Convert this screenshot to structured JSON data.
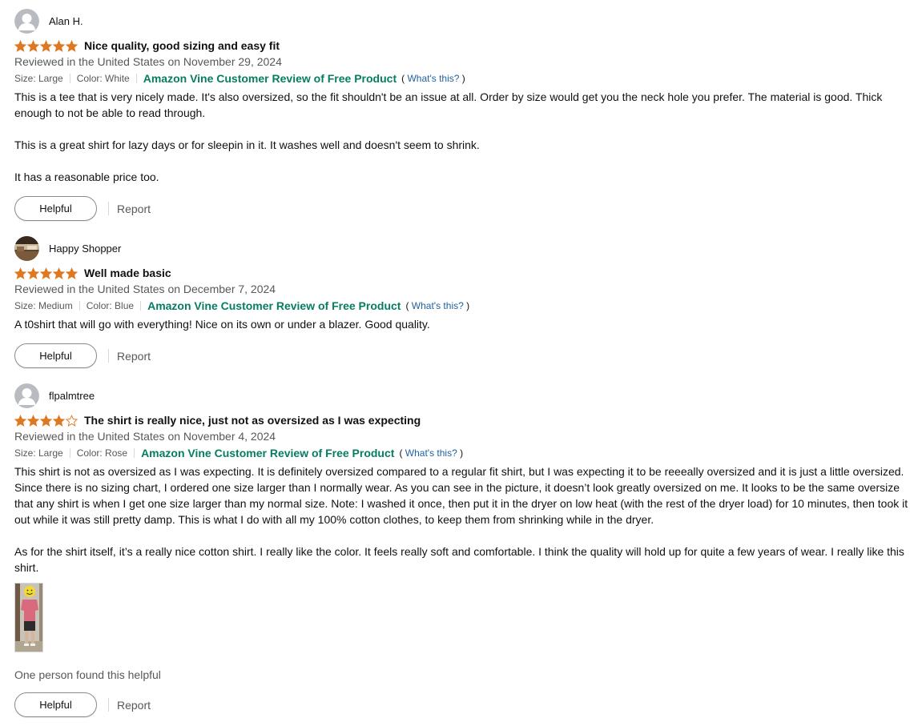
{
  "reviews": [
    {
      "author": "Alan H.",
      "rating": 5,
      "title": "Nice quality, good sizing and easy fit",
      "date": "Reviewed in the United States on November 29, 2024",
      "size": "Size: Large",
      "color": "Color: White",
      "vine_label": "Amazon Vine Customer Review of Free Product",
      "whats_open": "(",
      "whats_this": "What's this?",
      "whats_close": ")",
      "paragraphs": [
        "This is a tee that is very nicely made. It's also oversized, so the fit shouldn't be an issue at all. Order by size would get you the neck hole you prefer. The material is good. Thick enough to not be able to read through.",
        "This is a great shirt for lazy days or for sleepin in it. It washes well and doesn't seem to shrink.",
        "It has a reasonable price too."
      ],
      "helpful_label": "Helpful",
      "report_label": "Report",
      "avatar": "default-avatar-icon"
    },
    {
      "author": "Happy Shopper",
      "rating": 5,
      "title": "Well made basic",
      "date": "Reviewed in the United States on December 7, 2024",
      "size": "Size: Medium",
      "color": "Color: Blue",
      "vine_label": "Amazon Vine Customer Review of Free Product",
      "whats_open": "(",
      "whats_this": "What's this?",
      "whats_close": ")",
      "paragraphs": [
        "A t0shirt that will go with everything! Nice on its own or under a blazer. Good quality."
      ],
      "helpful_label": "Helpful",
      "report_label": "Report",
      "avatar": "photo-avatar"
    },
    {
      "author": "flpalmtree",
      "rating": 4,
      "title": "The shirt is really nice, just not as oversized as I was expecting",
      "date": "Reviewed in the United States on November 4, 2024",
      "size": "Size: Large",
      "color": "Color: Rose",
      "vine_label": "Amazon Vine Customer Review of Free Product",
      "whats_open": "(",
      "whats_this": "What's this?",
      "whats_close": ")",
      "paragraphs": [
        "This shirt is not as oversized as I was expecting. It is definitely oversized compared to a regular fit shirt, but I was expecting it to be reeeally oversized and it is just a little oversized. Since there is no sizing chart, I ordered one size larger than I normally wear. As you can see in the picture, it doesn’t look greatly oversized on me. It looks to be the same oversize that any shirt is when I get one size larger than my normal size. Note: I washed it once, then put it in the dryer on low heat (with the rest of the dryer load) for 10 minutes, then took it out while it was still pretty damp. This is what I do with all my 100% cotton clothes, to keep them from shrinking while in the dryer.",
        "As for the shirt itself, it’s a really nice cotton shirt. I really like the color. It feels really soft and comfortable. I think the quality will hold up for quite a few years of wear. I really like this shirt."
      ],
      "helpful_count": "One person found this helpful",
      "helpful_label": "Helpful",
      "report_label": "Report",
      "avatar": "default-avatar-icon"
    }
  ],
  "colors": {
    "star": "#de7921",
    "vine_green": "#067d62",
    "link_blue": "#2162a1",
    "secondary_text": "#565959"
  }
}
